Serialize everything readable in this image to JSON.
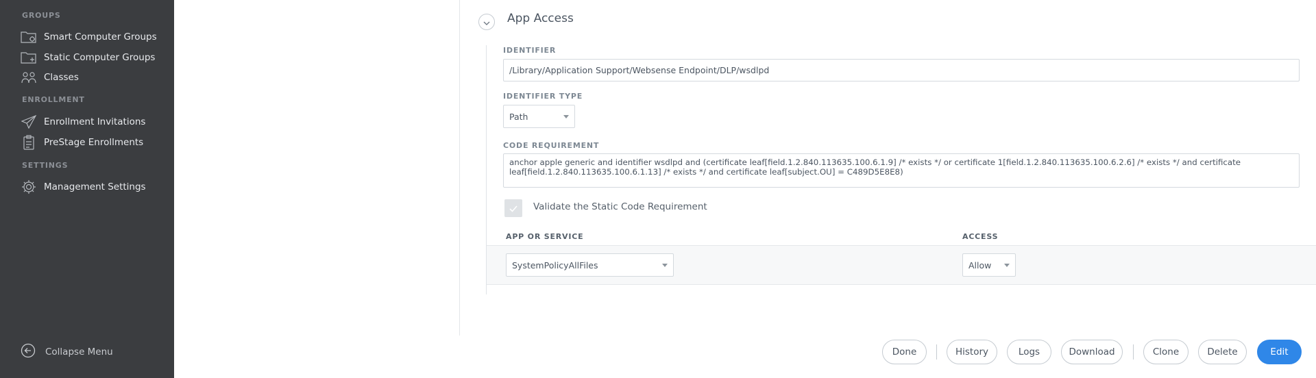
{
  "sidebar": {
    "sections": {
      "groups": "GROUPS",
      "enrollment": "ENROLLMENT",
      "settings": "SETTINGS"
    },
    "items": {
      "smart_groups": {
        "label": "Smart Computer Groups",
        "icon": "smart-group-folder-icon"
      },
      "static_groups": {
        "label": "Static Computer Groups",
        "icon": "static-group-folder-icon"
      },
      "classes": {
        "label": "Classes",
        "icon": "people-icon"
      },
      "enrollment_invitations": {
        "label": "Enrollment Invitations",
        "icon": "paper-plane-icon"
      },
      "prestage": {
        "label": "PreStage Enrollments",
        "icon": "clipboard-icon"
      },
      "management_settings": {
        "label": "Management Settings",
        "icon": "gear-icon"
      }
    },
    "collapse": {
      "label": "Collapse Menu",
      "icon": "circle-arrow-left-icon"
    }
  },
  "section": {
    "title": "App Access",
    "identifier_label": "IDENTIFIER",
    "identifier_value": "/Library/Application Support/Websense Endpoint/DLP/wsdlpd",
    "identifier_type_label": "IDENTIFIER TYPE",
    "identifier_type_value": "Path",
    "code_requirement_label": "CODE REQUIREMENT",
    "code_requirement_value": "anchor apple generic and identifier wsdlpd and (certificate leaf[field.1.2.840.113635.100.6.1.9] /* exists */ or certificate 1[field.1.2.840.113635.100.6.2.6] /* exists */ and certificate leaf[field.1.2.840.113635.100.6.1.13] /* exists */ and certificate leaf[subject.OU] = C489D5E8E8)",
    "validate_label": "Validate the Static Code Requirement",
    "validate_checked": true
  },
  "table": {
    "headers": {
      "app": "APP OR SERVICE",
      "access": "ACCESS"
    },
    "rows": [
      {
        "app": "SystemPolicyAllFiles",
        "access": "Allow"
      }
    ]
  },
  "footer": {
    "done": "Done",
    "history": "History",
    "logs": "Logs",
    "download": "Download",
    "clone": "Clone",
    "delete": "Delete",
    "edit": "Edit"
  },
  "colors": {
    "sidebar_bg": "#3b3d40",
    "primary": "#2f87e8"
  }
}
